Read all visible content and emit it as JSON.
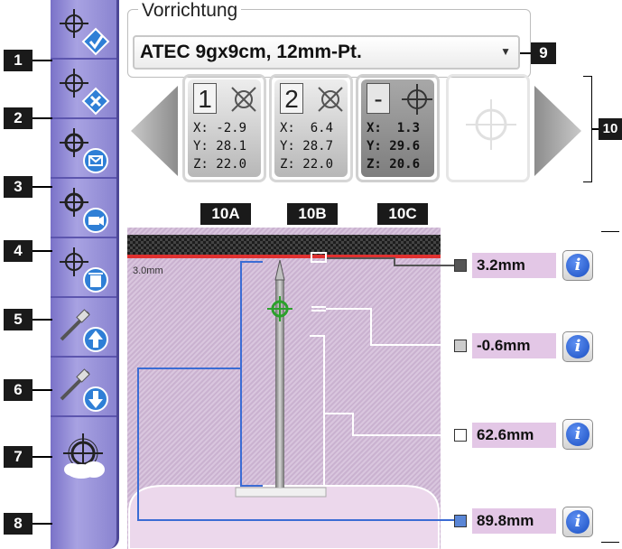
{
  "toolbar": {
    "callouts": [
      "1",
      "2",
      "3",
      "4",
      "5",
      "6",
      "7",
      "8"
    ],
    "tools": [
      {
        "icon": "crosshair-check-icon"
      },
      {
        "icon": "crosshair-x-icon"
      },
      {
        "icon": "crosshair-send-icon"
      },
      {
        "icon": "crosshair-camera-icon"
      },
      {
        "icon": "crosshair-trash-icon"
      },
      {
        "icon": "needle-up-icon"
      },
      {
        "icon": "needle-down-icon"
      },
      {
        "icon": "crosshair-cloud-icon"
      }
    ]
  },
  "device": {
    "label": "Vorrichtung",
    "value": "ATEC 9gx9cm, 12mm-Pt.",
    "callout": "9"
  },
  "targets": {
    "callout": "10",
    "cards": [
      {
        "num": "1",
        "x": "X: -2.9",
        "y": "Y: 28.1",
        "z": "Z: 22.0",
        "label": "10A"
      },
      {
        "num": "2",
        "x": "X:  6.4",
        "y": "Y: 28.7",
        "z": "Z: 22.0",
        "label": "10B"
      },
      {
        "num": "-",
        "x": "X:  1.3",
        "y": "Y: 29.6",
        "z": "Z: 20.6",
        "label": "10C"
      }
    ]
  },
  "needle": {
    "scale_label": "3.0mm",
    "measurements": [
      {
        "value": "3.2mm",
        "color": "#555555"
      },
      {
        "value": "-0.6mm",
        "color": "#cccccc"
      },
      {
        "value": "62.6mm",
        "color": "#ffffff"
      },
      {
        "value": "89.8mm",
        "color": "#5a86d6"
      }
    ]
  },
  "colors": {
    "toolbar": "#8a84d0",
    "accent_blue": "#2f7fd6",
    "needle_line": "#e03030",
    "panel": "#d9c6de"
  }
}
